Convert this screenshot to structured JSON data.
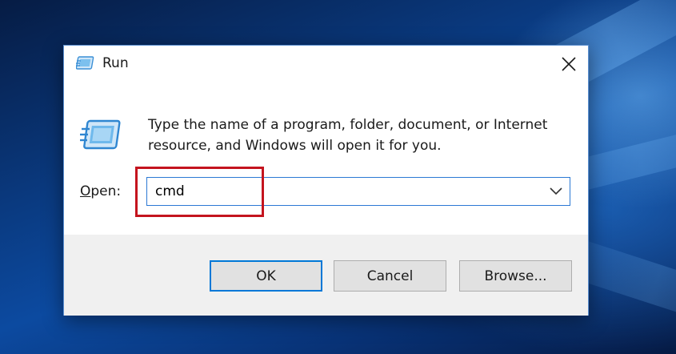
{
  "window": {
    "title": "Run",
    "icon": "run-icon",
    "close_icon": "close-icon"
  },
  "body": {
    "icon": "run-icon",
    "description": "Type the name of a program, folder, document, or Internet resource, and Windows will open it for you."
  },
  "open_field": {
    "label_accel": "O",
    "label_rest": "pen:",
    "value": "cmd",
    "dropdown_icon": "chevron-down-icon"
  },
  "buttons": {
    "ok_label": "OK",
    "cancel_label": "Cancel",
    "browse_label": "Browse..."
  },
  "colors": {
    "focus_border": "#0078d7",
    "highlight": "#c4141e",
    "footer_bg": "#f0f0f0"
  }
}
